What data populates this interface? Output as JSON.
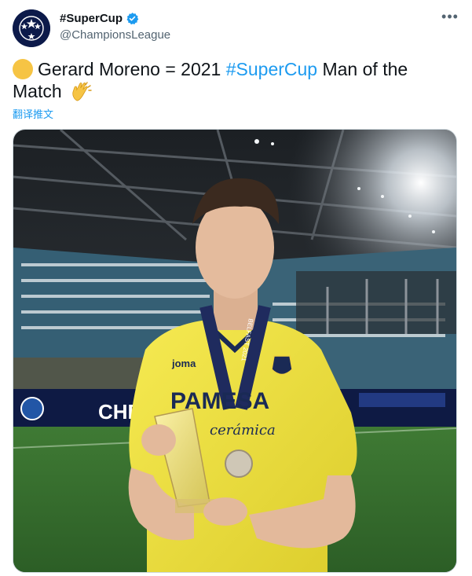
{
  "account": {
    "display_name": "#SuperCup",
    "handle": "@ChampionsLeague",
    "verified": true,
    "avatar_icon": "starball-icon"
  },
  "tweet": {
    "text_before": "Gerard Moreno = 2021 ",
    "hashtag": "#SuperCup",
    "text_after": " Man of the Match",
    "leading_emoji": "yellow-circle-emoji",
    "trailing_emoji": "clapping-hands-emoji",
    "translate_label": "翻译推文"
  },
  "media": {
    "description_icon": "photo",
    "ad_board_text": "CHE",
    "shirt_sponsor": "PAMESA",
    "shirt_sponsor_sub": "cerámica",
    "medal_ribbon_text": "BELFAST 2021",
    "brand_mark": "joma"
  },
  "colors": {
    "accent": "#1d9bf0",
    "text": "#0f1419",
    "muted": "#536471"
  }
}
